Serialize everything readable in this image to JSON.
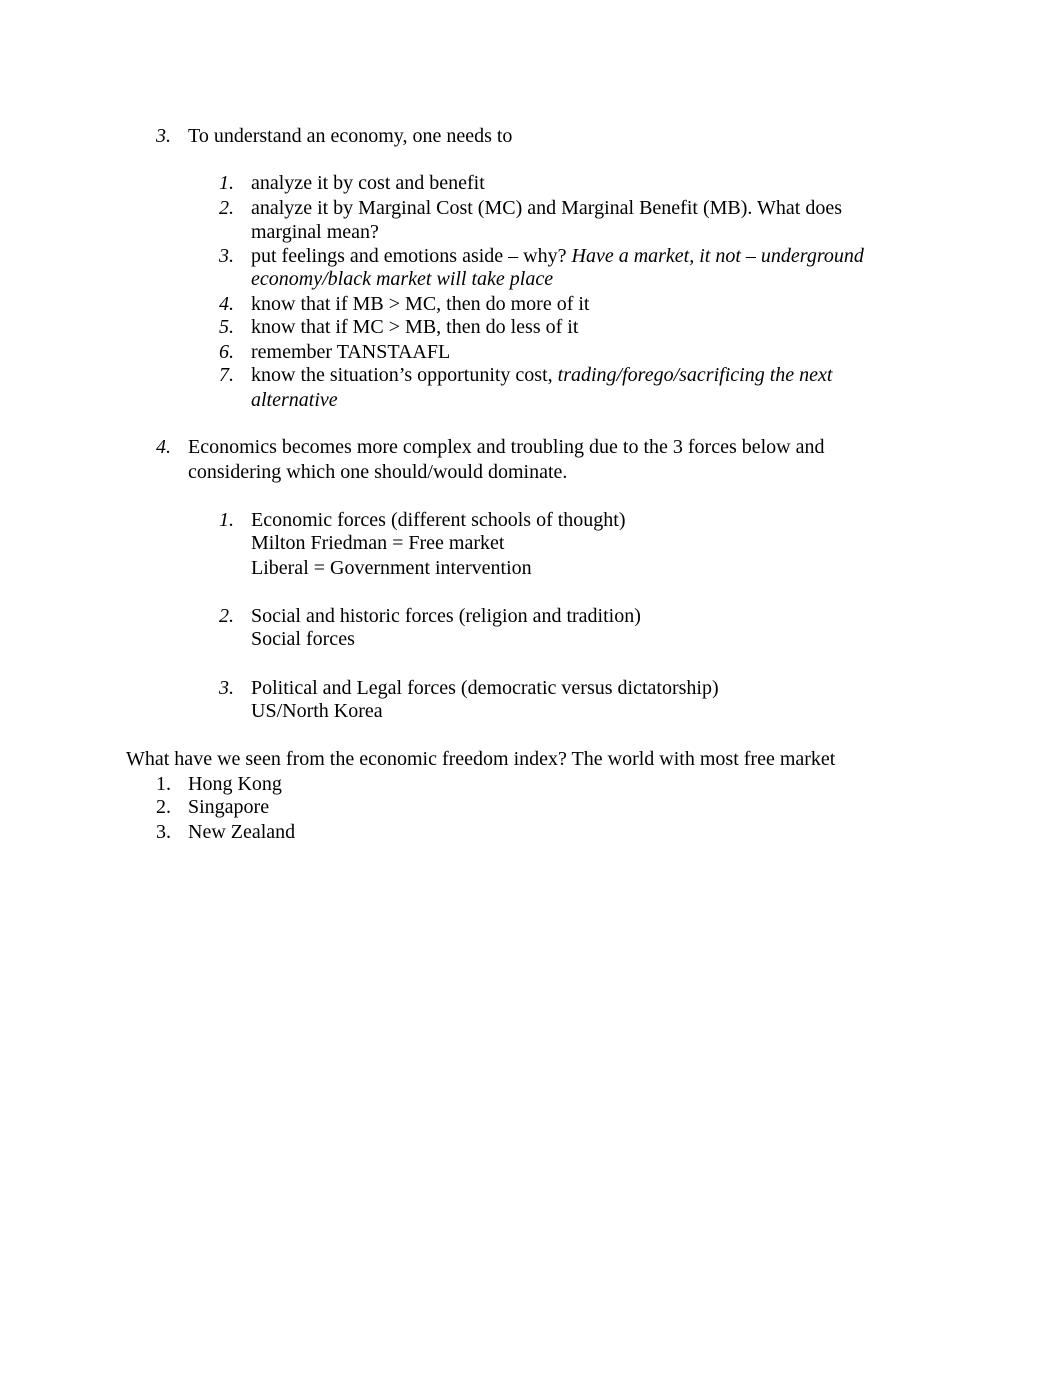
{
  "document": {
    "section3": {
      "number": "3.",
      "heading": "To understand an economy, one needs to",
      "items": [
        {
          "number": "1.",
          "lines": [
            {
              "text": "analyze it by cost and benefit",
              "italic": ""
            }
          ]
        },
        {
          "number": "2.",
          "lines": [
            {
              "text": "analyze it by Marginal Cost (MC) and Marginal Benefit (MB). What does",
              "italic": ""
            },
            {
              "text": "marginal mean?",
              "italic": ""
            }
          ]
        },
        {
          "number": "3.",
          "lines": [
            {
              "text": "put feelings and emotions aside – why? ",
              "italic": "Have a market, it not – underground"
            },
            {
              "text": "",
              "italic": "economy/black market will take place"
            }
          ]
        },
        {
          "number": "4.",
          "lines": [
            {
              "text": "know that if MB > MC, then do more of it",
              "italic": ""
            }
          ]
        },
        {
          "number": "5.",
          "lines": [
            {
              "text": "know that if MC > MB, then do less of it",
              "italic": ""
            }
          ]
        },
        {
          "number": "6.",
          "lines": [
            {
              "text": "remember TANSTAAFL",
              "italic": ""
            }
          ]
        },
        {
          "number": "7.",
          "lines": [
            {
              "text": "know the situation’s opportunity cost, ",
              "italic": "trading/forego/sacrificing the next"
            },
            {
              "text": "",
              "italic": "alternative"
            }
          ]
        }
      ]
    },
    "section4": {
      "number": "4.",
      "heading_lines": [
        "Economics becomes more complex and troubling due to the 3 forces below and",
        "considering which one should/would dominate."
      ],
      "items": [
        {
          "number": "1.",
          "lines": [
            "Economic forces (different schools of thought)",
            "Milton Friedman = Free market",
            "Liberal = Government intervention"
          ]
        },
        {
          "number": "2.",
          "lines": [
            "Social and historic forces (religion and tradition)",
            "Social forces"
          ]
        },
        {
          "number": "3.",
          "lines": [
            "Political and Legal forces (democratic versus dictatorship)",
            "US/North Korea"
          ]
        }
      ]
    },
    "freedom_index": {
      "question": "What have we seen from the economic freedom index? The world with most free market",
      "items": [
        {
          "number": "1.",
          "text": "Hong Kong"
        },
        {
          "number": "2.",
          "text": "Singapore"
        },
        {
          "number": "3.",
          "text": "New Zealand"
        }
      ]
    }
  }
}
